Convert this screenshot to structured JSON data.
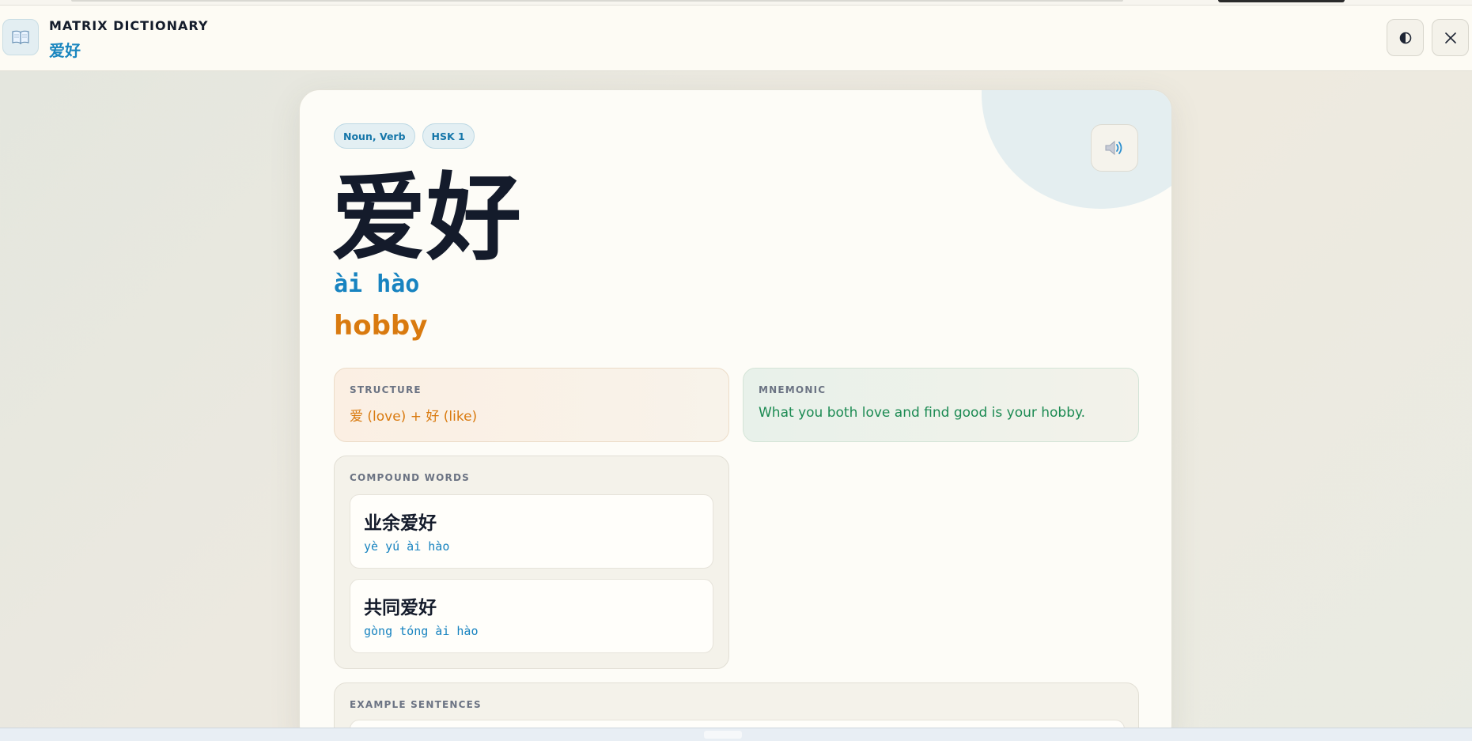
{
  "header": {
    "logo_icon": "book-icon",
    "title": "MATRIX DICTIONARY",
    "current_word": "爱好",
    "theme_icon": "contrast-icon",
    "close_icon": "close-icon"
  },
  "word": {
    "tags": [
      "Noun, Verb",
      "HSK 1"
    ],
    "hanzi": "爱好",
    "pinyin": "ài hào",
    "meaning": "hobby",
    "audio_icon": "speaker-icon"
  },
  "structure": {
    "label": "STRUCTURE",
    "value": "爱 (love) + 好 (like)"
  },
  "mnemonic": {
    "label": "MNEMONIC",
    "value": "What you both love and find good is your hobby."
  },
  "compounds": {
    "label": "COMPOUND WORDS",
    "items": [
      {
        "word": "业余爱好",
        "pinyin": "yè yú ài hào"
      },
      {
        "word": "共同爱好",
        "pinyin": "gòng tóng ài hào"
      }
    ]
  },
  "examples": {
    "label": "EXAMPLE SENTENCES"
  },
  "colors": {
    "accent_blue": "#1783c0",
    "accent_orange": "#d97a0f",
    "accent_green": "#1b8a52",
    "ink": "#141b2b"
  }
}
